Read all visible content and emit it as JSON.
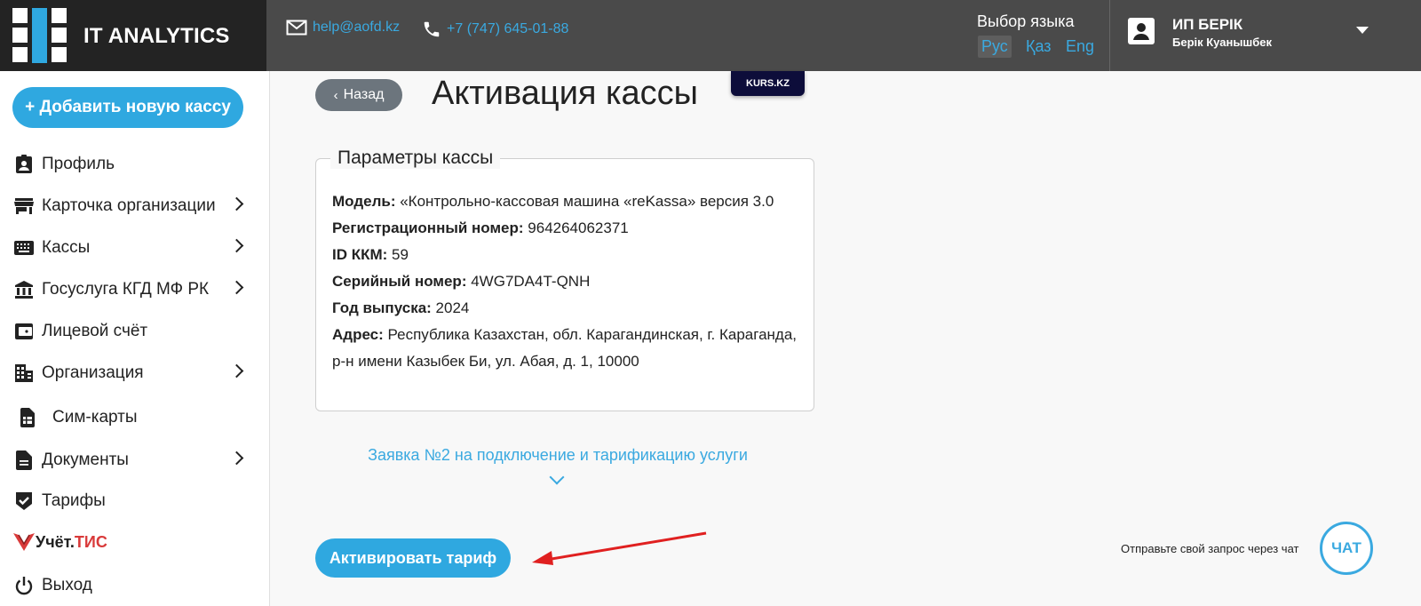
{
  "header": {
    "logo_text": "IT ANALYTICS",
    "email": "help@aofd.kz",
    "phone": "+7 (747) 645-01-88",
    "language_title": "Выбор языка",
    "languages": [
      "Рус",
      "Қаз",
      "Eng"
    ],
    "active_language": "Рус",
    "user_name": "ИП БЕРІК",
    "user_sub": "Берік Куанышбек"
  },
  "sidebar": {
    "add_button": "+ Добавить новую кассу",
    "items": [
      {
        "label": "Профиль",
        "icon": "profile-icon",
        "has_submenu": false
      },
      {
        "label": "Карточка организации",
        "icon": "store-icon",
        "has_submenu": true
      },
      {
        "label": "Кассы",
        "icon": "keyboard-icon",
        "has_submenu": true
      },
      {
        "label": "Госуслуга КГД МФ РК",
        "icon": "bank-icon",
        "has_submenu": true
      },
      {
        "label": "Лицевой счёт",
        "icon": "wallet-icon",
        "has_submenu": false
      },
      {
        "label": "Организация",
        "icon": "building-icon",
        "has_submenu": true
      },
      {
        "label": "Сим-карты",
        "icon": "sim-card-icon",
        "has_submenu": false
      },
      {
        "label": "Документы",
        "icon": "document-icon",
        "has_submenu": true
      },
      {
        "label": "Тарифы",
        "icon": "shield-check-icon",
        "has_submenu": false
      }
    ],
    "uchet_prefix": "Учёт.",
    "uchet_suffix": "ТИС",
    "logout": "Выход"
  },
  "main": {
    "back_button": "Назад",
    "page_title": "Активация кассы",
    "kurs_badge": "KURS.KZ",
    "params": {
      "legend": "Параметры кассы",
      "model_label": "Модель:",
      "model_value": "«Контрольно-кассовая машина «reKassa» версия 3.0",
      "reg_label": "Регистрационный номер:",
      "reg_value": "964264062371",
      "id_label": "ID ККМ:",
      "id_value": "59",
      "serial_label": "Серийный номер:",
      "serial_value": "4WG7DA4T-QNH",
      "year_label": "Год выпуска:",
      "year_value": "2024",
      "address_label": "Адрес:",
      "address_value": "Республика Казахстан, обл. Карагандинская, г. Караганда, р-н имени Казыбек Би, ул. Абая, д. 1, 10000"
    },
    "application_link": "Заявка №2 на подключение и тарификацию услуги",
    "activate_button": "Активировать тариф",
    "chat_hint": "Отправьте свой запрос через чат",
    "chat_button": "ЧАТ"
  },
  "colors": {
    "accent": "#2fa8e0",
    "header_bg": "#4a4a4a",
    "logo_bg": "#232323",
    "arrow": "#e02020"
  }
}
